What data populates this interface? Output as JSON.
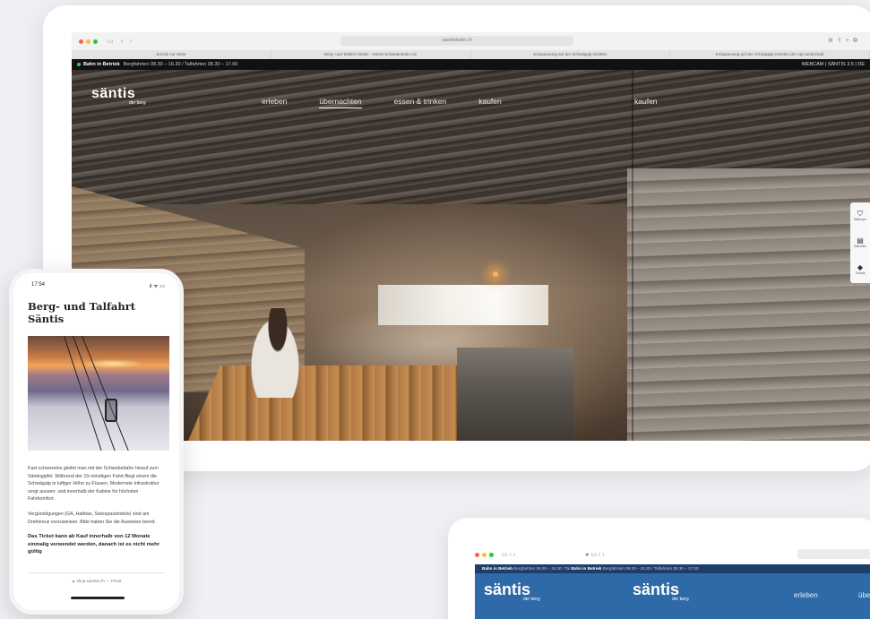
{
  "desktop": {
    "browser": {
      "url": "saentisbahn.ch",
      "tabs": [
        "Zurück zur Seite",
        "Berg- und Talfahrt Säntis - Säntis Schwebebahn AG",
        "Entspannung auf der Schwägalp inmitten",
        "Entspannung auf der Schwägalp inmitten der Alp Landschaft"
      ]
    },
    "status": {
      "label": "Bahn in Betrieb",
      "hours": "Bergfahrten 08.30 – 16.30 / Talfahrten 08.30 – 17.00",
      "right": "WEBCAM  |  SÄNTIS  3.5  |  DE"
    },
    "logo": {
      "name": "säntis",
      "tagline": "der berg"
    },
    "nav": {
      "erleben": "erleben",
      "uebernachten": "übernachten",
      "essen": "essen & trinken",
      "kaufen": "kaufen",
      "kaufen_dup": "kaufen"
    },
    "side_panel": {
      "item1": "Webcam",
      "item2": "Kalender",
      "item3": "Tickets"
    }
  },
  "phone": {
    "time": "17:54",
    "signal": "ıl ᯤ ▭",
    "title": "Berg- und Talfahrt Säntis",
    "paragraphs": [
      "Fast schwerelos gleitet man mit der Schwebebahn hinauf zum Säntisgipfel. Während der 10-minütigen Fahrt fliegt einem die Schwägalp in luftiger Höhe zu Füssen. Modernste Infrastruktur sorgt aussen- und innerhalb der Kabine für höchsten Fahrkomfort.",
      "Vergünstigungen (GA, Halbtax, Swisspasshotels) sind am Drehkreuz vorzuweisen. Bitte haben Sie die Ausweise bereit."
    ],
    "bold_note": "Das Ticket kann ab Kauf innerhalb von 12 Monate einmalig verwendet werden, danach ist es nicht mehr gültig",
    "footer": "▲ shop.saentis.ch — Privat"
  },
  "tablet": {
    "status_label_1": "Bahn in Betrieb",
    "status_hours_1": "Bergfahrten 08.30 – 16.30 / Tal",
    "status_label_2": "Bahn in Betrieb",
    "status_hours_2": "Bergfahrten 08.30 – 16.30 / Talfahrten 08.30 – 17.00",
    "logo_name": "säntis",
    "logo_tagline": "der berg",
    "nav_1": "erleben",
    "nav_2": "übe"
  },
  "colors": {
    "status_green": "#3ecf52",
    "tablet_blue": "#2f6aa8",
    "tablet_dark_blue": "#1d3d6a"
  }
}
